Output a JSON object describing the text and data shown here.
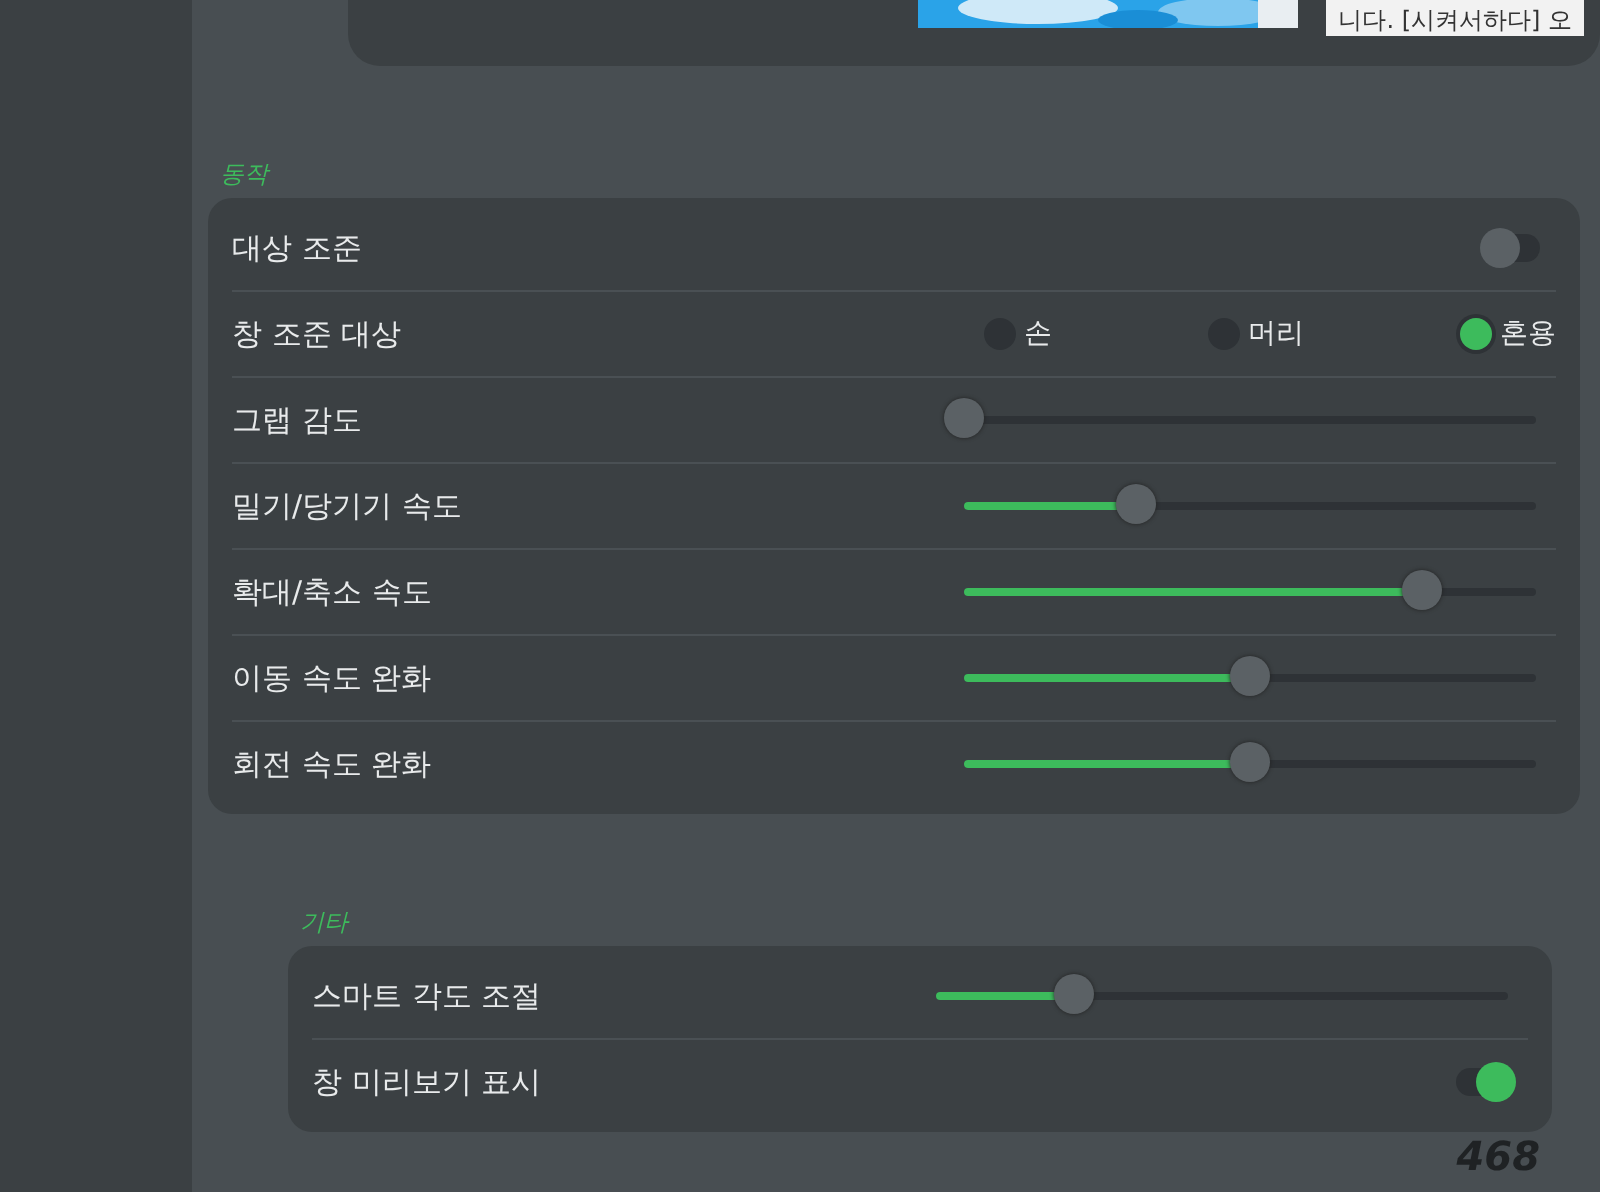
{
  "top_panel": {
    "snippet": "니다. [시켜서하다] 오"
  },
  "sections": [
    {
      "title": "동작",
      "rows": [
        {
          "kind": "toggle",
          "label": "대상 조준",
          "on": false
        },
        {
          "kind": "radio",
          "label": "창 조준 대상",
          "options": [
            {
              "label": "손",
              "selected": false
            },
            {
              "label": "머리",
              "selected": false
            },
            {
              "label": "혼용",
              "selected": true
            }
          ]
        },
        {
          "kind": "slider",
          "label": "그랩 감도",
          "level": 0
        },
        {
          "kind": "slider",
          "label": "밀기/당기기 속도",
          "level": 0.3
        },
        {
          "kind": "slider",
          "label": "확대/축소 속도",
          "level": 0.8
        },
        {
          "kind": "slider",
          "label": "이동 속도 완화",
          "level": 0.5
        },
        {
          "kind": "slider",
          "label": "회전 속도 완화",
          "level": 0.5
        }
      ]
    },
    {
      "title": "기타",
      "rows": [
        {
          "kind": "slider",
          "label": "스마트 각도 조절",
          "level": 0.24
        },
        {
          "kind": "toggle",
          "label": "창 미리보기 표시",
          "on": true
        }
      ]
    }
  ],
  "page_number": "468"
}
